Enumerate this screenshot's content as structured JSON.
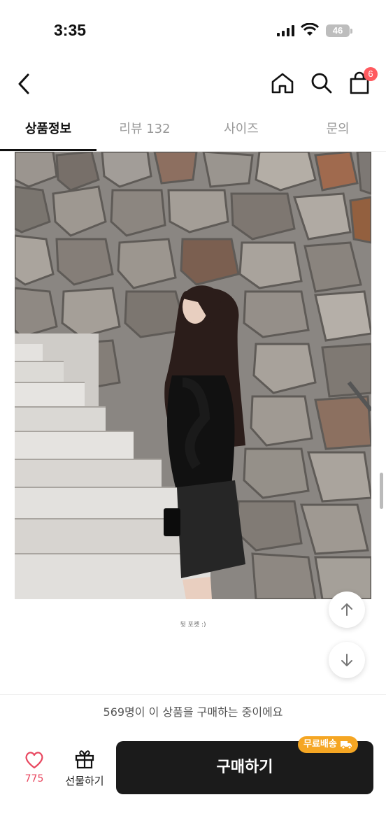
{
  "status_bar": {
    "time": "3:35",
    "battery": "46"
  },
  "header": {
    "cart_count": "6"
  },
  "tabs": [
    {
      "label": "상품정보",
      "active": true
    },
    {
      "label": "리뷰 132",
      "active": false
    },
    {
      "label": "사이즈",
      "active": false
    },
    {
      "label": "문의",
      "active": false
    }
  ],
  "content": {
    "caption": "뒷 포켓 :)"
  },
  "buyers_text": "569명이 이 상품을 구매하는 중이에요",
  "bottom_bar": {
    "like_count": "775",
    "gift_label": "선물하기",
    "buy_label": "구매하기",
    "shipping_badge": "무료배송"
  },
  "colors": {
    "like": "#e8475f",
    "badge": "#ff5a5f",
    "shipping": "#f5a623",
    "buy_bg": "#1b1b1b"
  }
}
